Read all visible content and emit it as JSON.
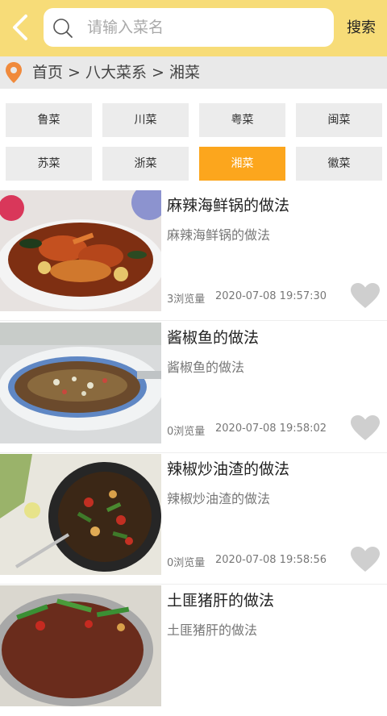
{
  "header": {
    "search_placeholder": "请输入菜名",
    "search_button": "搜索"
  },
  "breadcrumb": "首页 > 八大菜系 > 湘菜",
  "categories": [
    {
      "label": "鲁菜",
      "active": false
    },
    {
      "label": "川菜",
      "active": false
    },
    {
      "label": "粤菜",
      "active": false
    },
    {
      "label": "闽菜",
      "active": false
    },
    {
      "label": "苏菜",
      "active": false
    },
    {
      "label": "浙菜",
      "active": false
    },
    {
      "label": "湘菜",
      "active": true
    },
    {
      "label": "徽菜",
      "active": false
    }
  ],
  "recipes": [
    {
      "title": "麻辣海鲜锅的做法",
      "desc": "麻辣海鲜锅的做法",
      "views": "3浏览量",
      "date": "2020-07-08 19:57:30"
    },
    {
      "title": "酱椒鱼的做法",
      "desc": "酱椒鱼的做法",
      "views": "0浏览量",
      "date": "2020-07-08 19:58:02"
    },
    {
      "title": "辣椒炒油渣的做法",
      "desc": "辣椒炒油渣的做法",
      "views": "0浏览量",
      "date": "2020-07-08 19:58:56"
    },
    {
      "title": "土匪猪肝的做法",
      "desc": "土匪猪肝的做法",
      "views": "",
      "date": ""
    }
  ],
  "colors": {
    "header_bg": "#f7dc78",
    "active_category": "#fca61d",
    "heart": "#cfcfcf"
  }
}
